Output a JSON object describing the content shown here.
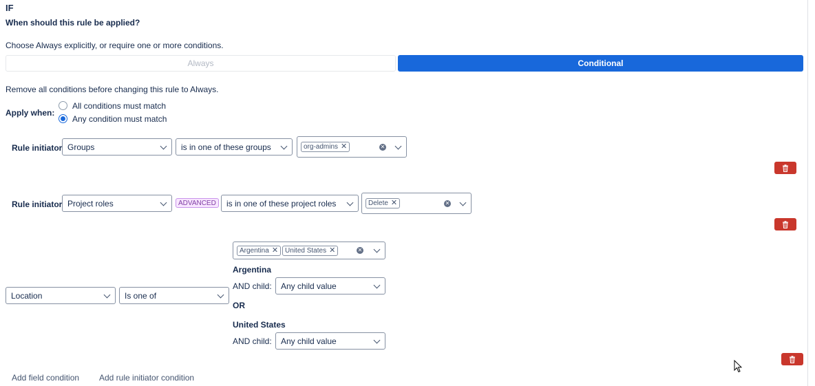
{
  "header": {
    "if_label": "IF",
    "question": "When should this rule be applied?",
    "instruction": "Choose Always explicitly, or require one or more conditions."
  },
  "mode_toggle": {
    "always_label": "Always",
    "conditional_label": "Conditional",
    "selected": "Conditional"
  },
  "notice": "Remove all conditions before changing this rule to Always.",
  "apply_when": {
    "label": "Apply when:",
    "options": [
      "All conditions must match",
      "Any condition must match"
    ],
    "selected": "Any condition must match"
  },
  "conditions": [
    {
      "label": "Rule initiator",
      "field": "Groups",
      "operator": "is in one of these groups",
      "values": [
        "org-admins"
      ]
    },
    {
      "label": "Rule initiator",
      "field": "Project roles",
      "badge": "ADVANCED",
      "operator": "is in one of these project roles",
      "values": [
        "Delete"
      ]
    },
    {
      "field": "Location",
      "operator": "Is one of",
      "values": [
        "Argentina",
        "United States"
      ],
      "children": [
        {
          "name": "Argentina",
          "child_label": "AND child:",
          "child_value": "Any child value"
        },
        {
          "name": "United States",
          "child_label": "AND child:",
          "child_value": "Any child value"
        }
      ],
      "or_label": "OR"
    }
  ],
  "footer": {
    "add_field": "Add field condition",
    "add_initiator": "Add rule initiator condition"
  },
  "colors": {
    "primary": "#1868db",
    "danger": "#c9372c",
    "advanced_bg": "#f8e6ff"
  }
}
